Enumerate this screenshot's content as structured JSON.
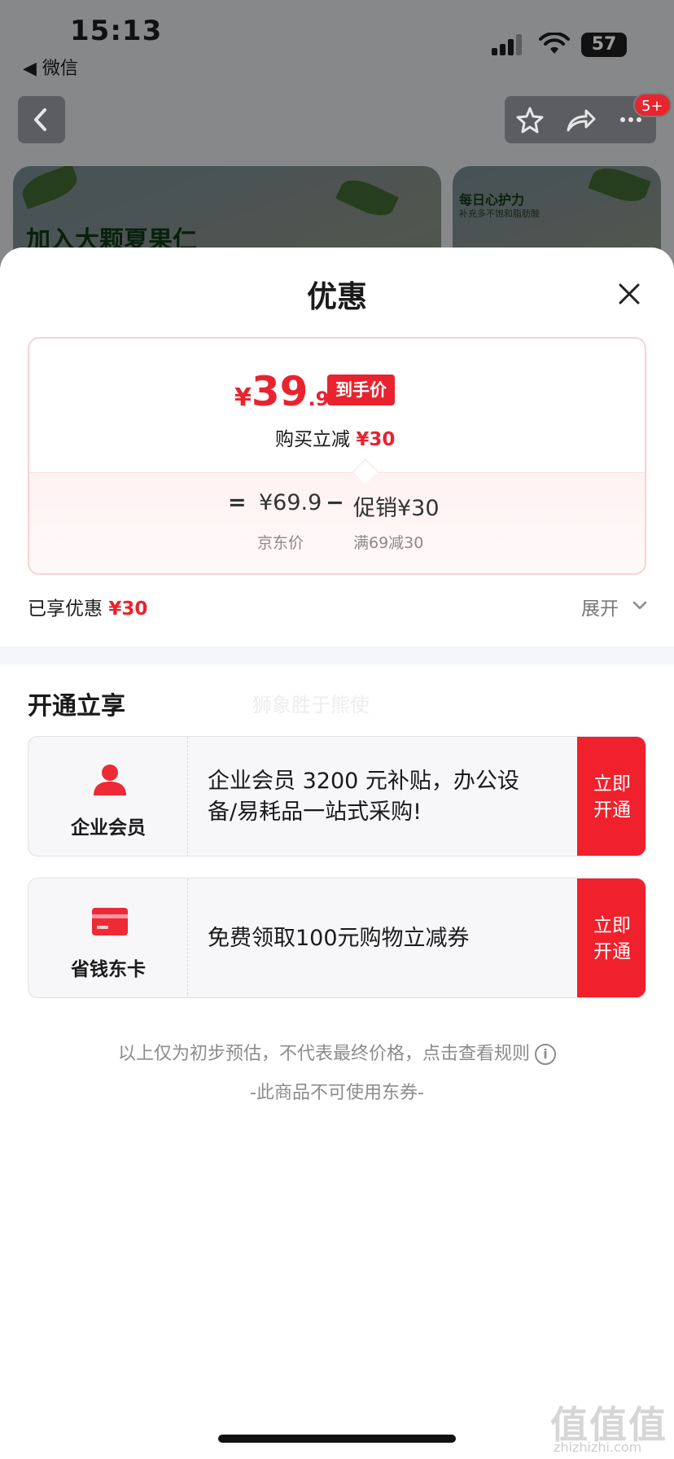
{
  "status_bar": {
    "time": "15:13",
    "back_app": "◀ 微信",
    "battery": "57"
  },
  "nav": {
    "badge": "5+"
  },
  "banners": [
    {
      "title": "加入大颗夏果仁"
    },
    {
      "title": "每日心护力",
      "subtitle": "补充多不饱和脂肪酸"
    }
  ],
  "sheet": {
    "title": "优惠",
    "price_card": {
      "currency": "¥",
      "price_int": "39",
      "price_dec": ".9",
      "tag": "到手价",
      "buy_off_label": "购买立减 ",
      "buy_off_value": "¥30",
      "eq": "=",
      "jd_price": "¥69.9",
      "minus": "−",
      "promo": "促销¥30",
      "jd_label": "京东价",
      "promo_label": "满69减30"
    },
    "enjoyed_label": "已享优惠 ",
    "enjoyed_value": "¥30",
    "expand_label": "展开",
    "section_title": "开通立享",
    "watermark": "狮象胜于熊使",
    "benefits": [
      {
        "name": "企业会员",
        "desc": "企业会员 3200 元补贴，办公设备/易耗品一站式采购!",
        "cta": "立即开通",
        "icon": "person-icon"
      },
      {
        "name": "省钱东卡",
        "desc": "免费领取100元购物立减券",
        "cta": "立即开通",
        "icon": "card-icon"
      }
    ],
    "disclaimer": "以上仅为初步预估，不代表最终价格，点击查看规则",
    "no_coupon": "-此商品不可使用东券-"
  },
  "corner_mark": {
    "logo": "值值值",
    "site": "zhizhizhi.com"
  },
  "colors": {
    "accent": "#e8232f",
    "cta": "#f0202c",
    "card_border": "#f7d2d6"
  }
}
